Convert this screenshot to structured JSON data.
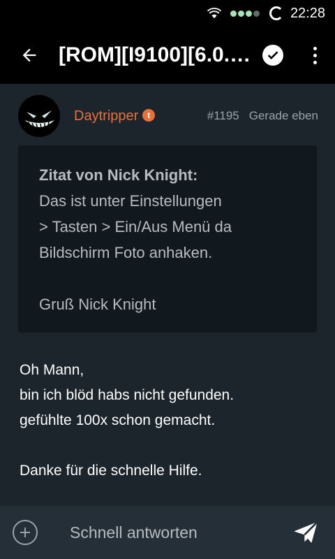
{
  "status_bar": {
    "time": "22:28",
    "icons": [
      "wifi-icon",
      "signal-icon",
      "sync-icon"
    ]
  },
  "app_bar": {
    "title": "[ROM][I9100][6.0.1]...",
    "icons": [
      "back-arrow-icon",
      "check-circle-icon",
      "more-vert-icon"
    ]
  },
  "post": {
    "username": "Daytripper",
    "badge": "t",
    "post_number": "#1195",
    "post_time": "Gerade eben",
    "quote": {
      "author": "Zitat von Nick Knight:",
      "lines": [
        "Das ist unter Einstellungen",
        "> Tasten > Ein/Aus Menü da",
        "Bildschirm Foto anhaken."
      ],
      "signature": "Gruß Nick Knight"
    },
    "body_lines": [
      "Oh Mann,",
      "bin ich blöd habs nicht gefunden.",
      "gefühlte 100x schon gemacht."
    ],
    "closing": "Danke für die schnelle Hilfe."
  },
  "reply_bar": {
    "placeholder": "Schnell antworten",
    "icons": [
      "add-circle-icon",
      "send-icon"
    ]
  },
  "colors": {
    "accent": "#e8703a",
    "background": "#1c252c",
    "quote_background": "#12191e",
    "bar": "#000000",
    "reply_bar": "#252f37"
  }
}
